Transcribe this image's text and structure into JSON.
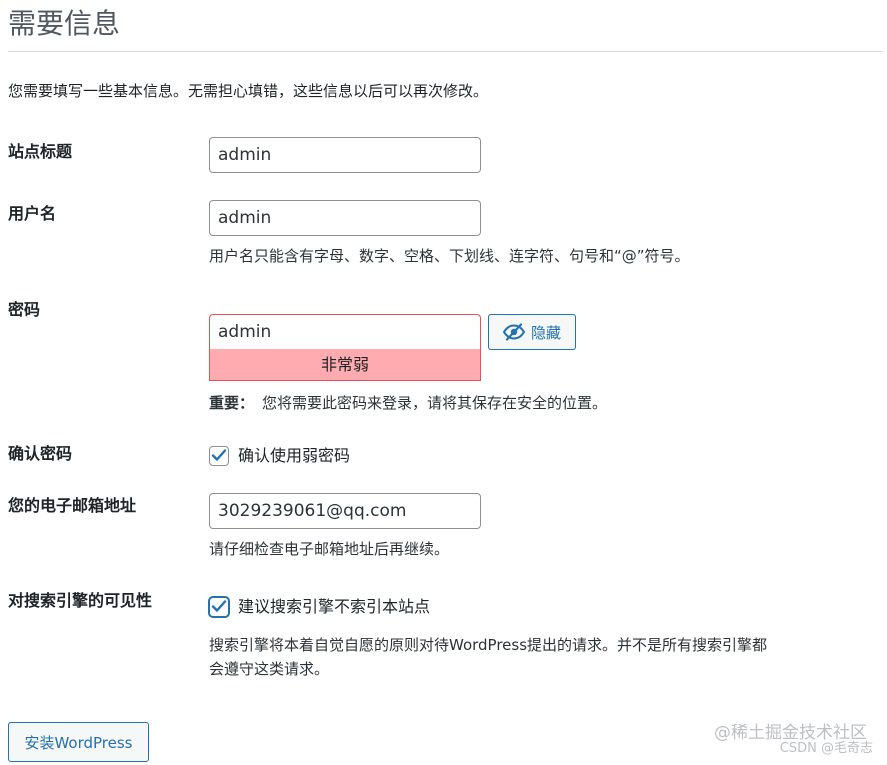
{
  "page_title": "需要信息",
  "intro": "您需要填写一些基本信息。无需担心填错，这些信息以后可以再次修改。",
  "fields": {
    "site_title": {
      "label": "站点标题",
      "value": "admin"
    },
    "username": {
      "label": "用户名",
      "value": "admin",
      "hint": "用户名只能含有字母、数字、空格、下划线、连字符、句号和“@”符号。"
    },
    "password": {
      "label": "密码",
      "value": "admin",
      "strength": "非常弱",
      "hide_label": "隐藏",
      "note_strong": "重要：",
      "note": "您将需要此密码来登录，请将其保存在安全的位置。"
    },
    "confirm_password": {
      "label": "确认密码",
      "checkbox_label": "确认使用弱密码",
      "checked": true
    },
    "email": {
      "label": "您的电子邮箱地址",
      "value": "3029239061@qq.com",
      "hint": "请仔细检查电子邮箱地址后再继续。"
    },
    "search_visibility": {
      "label": "对搜索引擎的可见性",
      "checkbox_label": "建议搜索引擎不索引本站点",
      "checked": true,
      "hint_line1": "搜索引擎将本着自觉自愿的原则对待WordPress提出的请求。并不是所有搜索引擎都",
      "hint_line2": "会遵守这类请求。"
    }
  },
  "install_button": "安装WordPress",
  "watermark": {
    "line1": "@稀土掘金技术社区",
    "line2": "CSDN @毛奇志"
  },
  "colors": {
    "accent": "#2271b1",
    "weak_bg": "#ffabaf",
    "weak_border": "#e65054"
  },
  "icons": {
    "hide": "eye-slash-icon",
    "check": "checkmark-icon"
  }
}
